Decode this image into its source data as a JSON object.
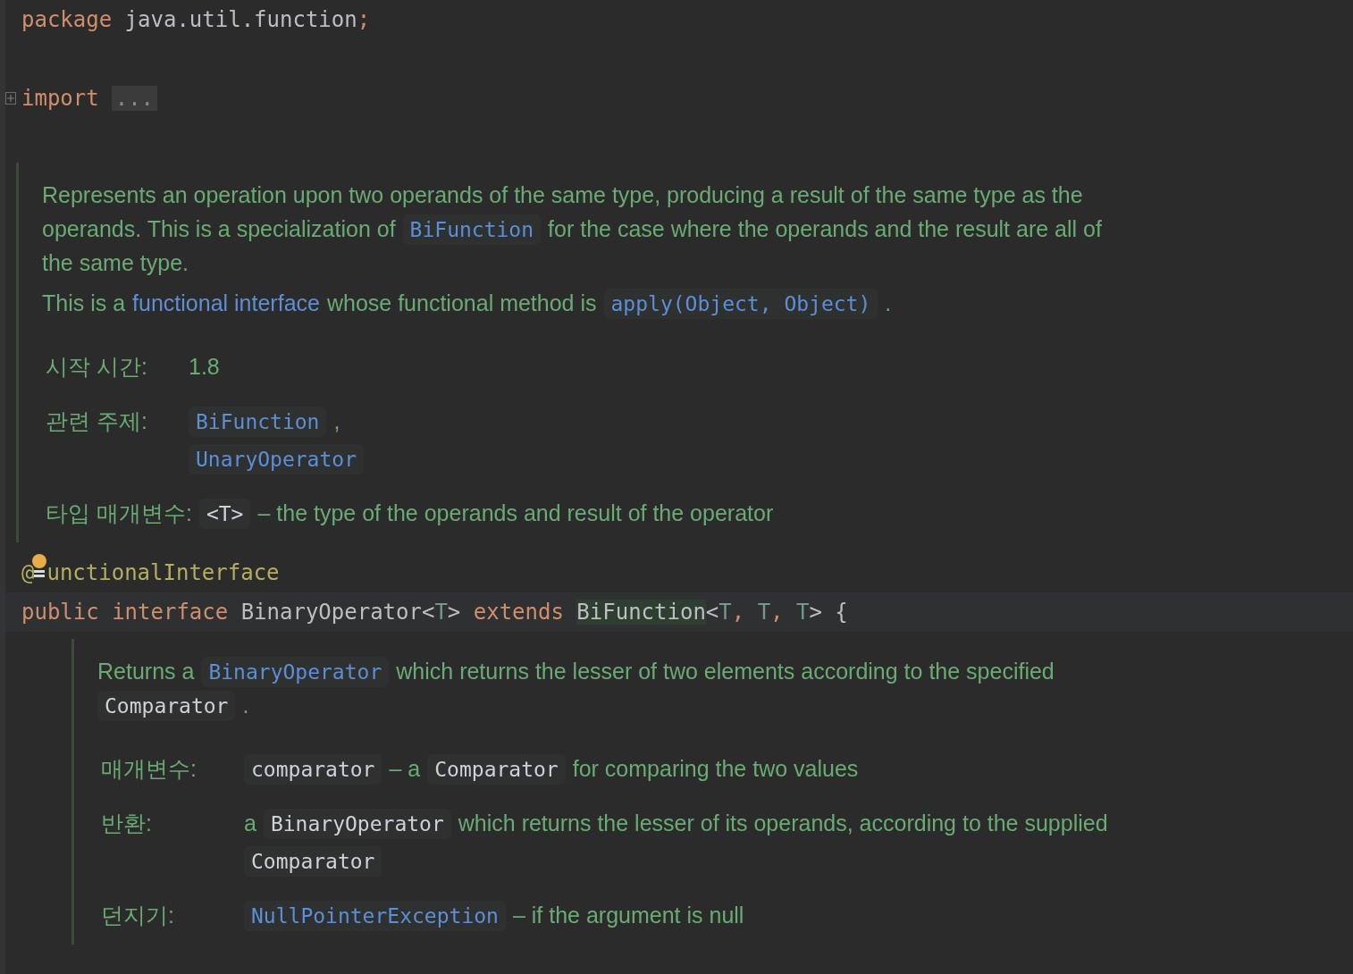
{
  "code_top": [
    {
      "tokens": [
        {
          "kind": "keyword",
          "text": "package"
        },
        {
          "kind": "plain",
          "text": " java.util.function"
        },
        {
          "kind": "keyword",
          "text": ";"
        }
      ]
    },
    {
      "folded": true,
      "tokens": [
        {
          "kind": "keyword",
          "text": "import"
        },
        {
          "kind": "fold",
          "text": "..."
        }
      ]
    }
  ],
  "doc_1": {
    "paragraphs": [
      [
        [
          {
            "kind": "text",
            "text": "Represents an operation upon two operands of the same type, producing a result of the same type as the"
          }
        ],
        [
          {
            "kind": "text",
            "text": "operands. This is a specialization of"
          },
          {
            "kind": "code_link",
            "text": "BiFunction"
          },
          {
            "kind": "text",
            "text": "for the case where the operands and the result are all of"
          }
        ],
        [
          {
            "kind": "text",
            "text": "the same type."
          }
        ]
      ],
      [
        [
          {
            "kind": "text",
            "text": "This is a"
          },
          {
            "kind": "link",
            "text": "functional interface"
          },
          {
            "kind": "text",
            "text": "whose functional method is"
          },
          {
            "kind": "code_link",
            "text": "apply(Object, Object)"
          },
          {
            "kind": "text",
            "text": "."
          }
        ]
      ]
    ],
    "tags": [
      {
        "label": "시작 시간:",
        "values": [
          [
            {
              "kind": "text",
              "text": "1.8"
            }
          ]
        ]
      },
      {
        "label": "관련 주제:",
        "values": [
          [
            {
              "kind": "code_link",
              "text": "BiFunction"
            },
            {
              "kind": "text",
              "text": ","
            }
          ],
          [
            {
              "kind": "code_link",
              "text": "UnaryOperator"
            }
          ]
        ]
      },
      {
        "label": "타입 매개변수:",
        "values": [
          [
            {
              "kind": "code",
              "text": "<T>"
            },
            {
              "kind": "text",
              "text": "– the type of the operands and result of the operator"
            }
          ]
        ]
      }
    ]
  },
  "code_mid": [
    {
      "bulb": true,
      "tokens": [
        {
          "kind": "annotation",
          "text": "@"
        },
        {
          "kind": "annotation",
          "text": "unctionalInterface"
        }
      ]
    },
    {
      "current": true,
      "tokens": [
        {
          "kind": "keyword",
          "text": "public interface "
        },
        {
          "kind": "plain",
          "text": "BinaryOperator<"
        },
        {
          "kind": "typeparam",
          "text": "T"
        },
        {
          "kind": "plain",
          "text": "> "
        },
        {
          "kind": "keyword",
          "text": "extends "
        },
        {
          "kind": "highlight",
          "text": "BiFunction"
        },
        {
          "kind": "plain",
          "text": "<"
        },
        {
          "kind": "typeparam",
          "text": "T"
        },
        {
          "kind": "keyword",
          "text": ", "
        },
        {
          "kind": "typeparam",
          "text": "T"
        },
        {
          "kind": "keyword",
          "text": ", "
        },
        {
          "kind": "typeparam",
          "text": "T"
        },
        {
          "kind": "plain",
          "text": "> {"
        }
      ]
    }
  ],
  "doc_2": {
    "paragraphs": [
      [
        [
          {
            "kind": "text",
            "text": "Returns a"
          },
          {
            "kind": "code_link",
            "text": "BinaryOperator"
          },
          {
            "kind": "text",
            "text": "which returns the lesser of two elements according to the specified"
          }
        ],
        [
          {
            "kind": "code",
            "text": "Comparator"
          },
          {
            "kind": "text",
            "text": "."
          }
        ]
      ]
    ],
    "tags": [
      {
        "label": "매개변수:",
        "values": [
          [
            {
              "kind": "code",
              "text": "comparator"
            },
            {
              "kind": "text",
              "text": "– a"
            },
            {
              "kind": "code",
              "text": "Comparator"
            },
            {
              "kind": "text",
              "text": "for comparing the two values"
            }
          ]
        ]
      },
      {
        "label": "반환:",
        "values": [
          [
            {
              "kind": "text",
              "text": "a"
            },
            {
              "kind": "code",
              "text": "BinaryOperator"
            },
            {
              "kind": "text",
              "text": "which returns the lesser of its operands, according to the supplied"
            }
          ],
          [
            {
              "kind": "code",
              "text": "Comparator"
            }
          ]
        ]
      },
      {
        "label": "던지기:",
        "values": [
          [
            {
              "kind": "code_link",
              "text": "NullPointerException"
            },
            {
              "kind": "text",
              "text": "– if the argument is null"
            }
          ]
        ]
      }
    ]
  }
}
